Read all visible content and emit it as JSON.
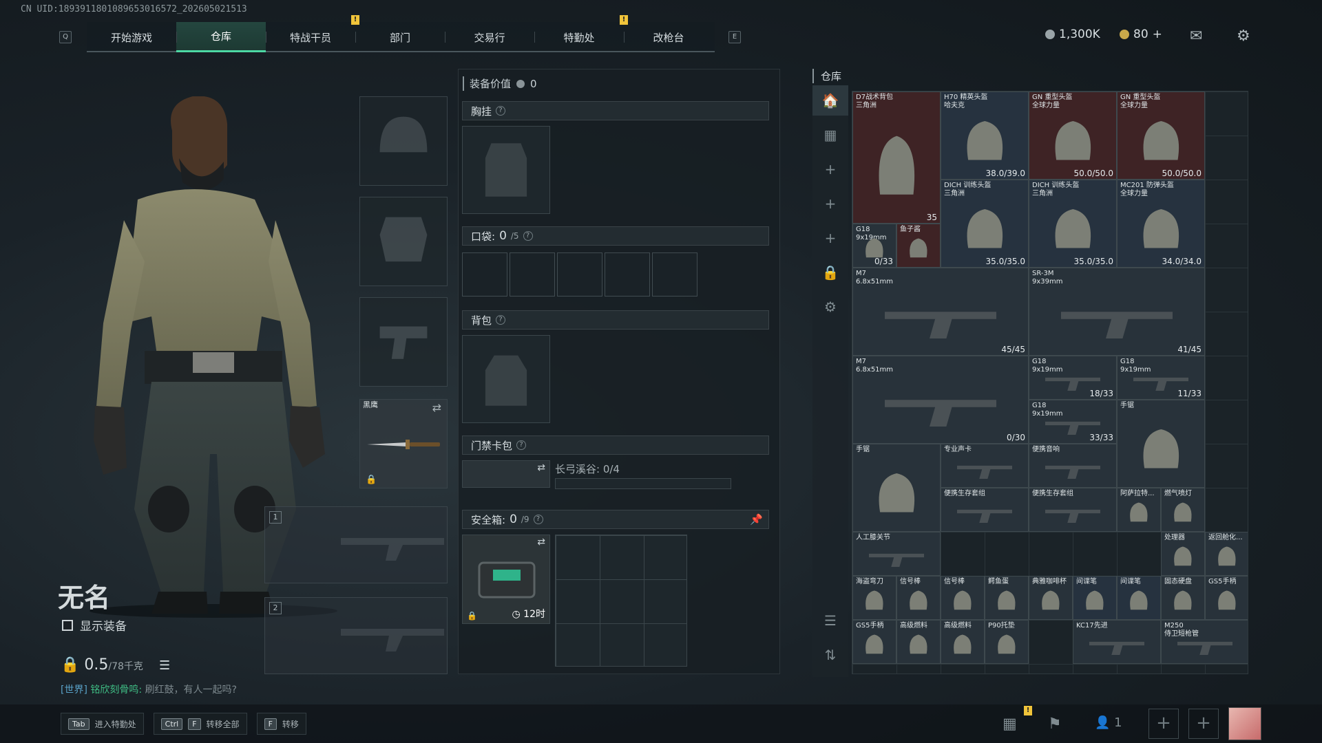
{
  "uid": "CN UID:1893911801089653016572_202605021513",
  "nav": {
    "left_key": "Q",
    "right_key": "E",
    "tabs": [
      {
        "label": "开始游戏",
        "active": false,
        "alert": false
      },
      {
        "label": "仓库",
        "active": true,
        "alert": false
      },
      {
        "label": "特战干员",
        "active": false,
        "alert": true
      },
      {
        "label": "部门",
        "active": false,
        "alert": false
      },
      {
        "label": "交易行",
        "active": false,
        "alert": false
      },
      {
        "label": "特勤处",
        "active": false,
        "alert": true
      },
      {
        "label": "改枪台",
        "active": false,
        "alert": false
      }
    ],
    "alert_symbol": "!"
  },
  "currency": {
    "money": "1,300K",
    "coin": "80",
    "coin_add": "+"
  },
  "character": {
    "name": "无名",
    "show_equipment": "显示装备",
    "weight": "0.5",
    "weight_max": "/78千克",
    "melee_name": "黑鹰",
    "weapon_slot_1": "1",
    "weapon_slot_2": "2"
  },
  "chat": {
    "channel": "[世界]",
    "user": "铭欣刻骨鸣:",
    "message": "刷红鼓，有人一起吗?"
  },
  "bottom_keys": [
    {
      "keys": [
        "Tab"
      ],
      "label": "进入特勤处"
    },
    {
      "keys": [
        "Ctrl",
        "F"
      ],
      "label": "转移全部"
    },
    {
      "keys": [
        "F"
      ],
      "label": "转移"
    }
  ],
  "loadout": {
    "value_label": "装备价值",
    "value": "0",
    "chest_rig": "胸挂",
    "pocket_label": "口袋:",
    "pocket_count": "0",
    "pocket_max": "/5",
    "backpack": "背包",
    "keycard": "门禁卡包",
    "keycard_map": "长弓溪谷: 0/4",
    "safebox_label": "安全箱:",
    "safebox_count": "0",
    "safebox_max": "/9",
    "safebox_timer": "12时",
    "help": "?"
  },
  "warehouse": {
    "title": "仓库",
    "items": [
      {
        "name": "D7战术背包",
        "sub": "三角洲",
        "count": "35",
        "style": "red"
      },
      {
        "name": "H70 精英头盔",
        "sub": "哈夫克",
        "count": "38.0/39.0",
        "style": "blue"
      },
      {
        "name": "GN 重型头盔",
        "sub": "全球力量",
        "count": "50.0/50.0",
        "style": "red"
      },
      {
        "name": "GN 重型头盔",
        "sub": "全球力量",
        "count": "50.0/50.0",
        "style": "red"
      },
      {
        "name": "DICH 训练头盔",
        "sub": "三角洲",
        "count": "35.0/35.0",
        "style": "blue"
      },
      {
        "name": "DICH 训练头盔",
        "sub": "三角洲",
        "count": "35.0/35.0",
        "style": "blue"
      },
      {
        "name": "MC201 防弹头盔",
        "sub": "全球力量",
        "count": "34.0/34.0",
        "style": "blue"
      },
      {
        "name": "G18",
        "sub": "9x19mm",
        "count": "0/33",
        "style": ""
      },
      {
        "name": "鱼子酱",
        "sub": "",
        "count": "",
        "style": "red"
      },
      {
        "name": "M7",
        "sub": "6.8x51mm",
        "count": "45/45",
        "style": ""
      },
      {
        "name": "SR-3M",
        "sub": "9x39mm",
        "count": "41/45",
        "style": ""
      },
      {
        "name": "M7",
        "sub": "6.8x51mm",
        "count": "0/30",
        "style": ""
      },
      {
        "name": "G18",
        "sub": "9x19mm",
        "count": "18/33",
        "style": ""
      },
      {
        "name": "G18",
        "sub": "9x19mm",
        "count": "11/33",
        "style": ""
      },
      {
        "name": "G18",
        "sub": "9x19mm",
        "count": "33/33",
        "style": ""
      },
      {
        "name": "手锯",
        "sub": "",
        "count": "",
        "style": ""
      },
      {
        "name": "手锯",
        "sub": "",
        "count": "",
        "style": ""
      },
      {
        "name": "专业声卡",
        "sub": "",
        "count": "",
        "style": ""
      },
      {
        "name": "便携音响",
        "sub": "",
        "count": "",
        "style": ""
      },
      {
        "name": "阿萨拉特...",
        "sub": "",
        "count": "",
        "style": ""
      },
      {
        "name": "便携生存套组",
        "sub": "",
        "count": "",
        "style": ""
      },
      {
        "name": "便携生存套组",
        "sub": "",
        "count": "",
        "style": ""
      },
      {
        "name": "燃气喷灯",
        "sub": "",
        "count": "",
        "style": ""
      },
      {
        "name": "人工膝关节",
        "sub": "",
        "count": "",
        "style": ""
      },
      {
        "name": "处理器",
        "sub": "",
        "count": "",
        "style": ""
      },
      {
        "name": "返回舱化...",
        "sub": "",
        "count": "",
        "style": ""
      },
      {
        "name": "海盗弯刀",
        "sub": "",
        "count": "",
        "style": ""
      },
      {
        "name": "信号棒",
        "sub": "",
        "count": "",
        "style": ""
      },
      {
        "name": "信号棒",
        "sub": "",
        "count": "",
        "style": ""
      },
      {
        "name": "鳄鱼蛋",
        "sub": "",
        "count": "",
        "style": ""
      },
      {
        "name": "典雅咖啡杯",
        "sub": "",
        "count": "",
        "style": ""
      },
      {
        "name": "间谍笔",
        "sub": "",
        "count": "",
        "style": "blue"
      },
      {
        "name": "间谍笔",
        "sub": "",
        "count": "",
        "style": "blue"
      },
      {
        "name": "固态硬盘",
        "sub": "",
        "count": "",
        "style": ""
      },
      {
        "name": "GS5手柄",
        "sub": "",
        "count": "",
        "style": ""
      },
      {
        "name": "GS5手柄",
        "sub": "",
        "count": "",
        "style": ""
      },
      {
        "name": "高级燃料",
        "sub": "",
        "count": "",
        "style": ""
      },
      {
        "name": "高级燃料",
        "sub": "",
        "count": "",
        "style": ""
      },
      {
        "name": "P90托垫",
        "sub": "",
        "count": "",
        "style": ""
      },
      {
        "name": "KC17先进",
        "sub": "",
        "count": "",
        "style": ""
      },
      {
        "name": "M250",
        "sub": "侍卫短枪管",
        "count": "",
        "style": ""
      }
    ]
  },
  "bottom_right": {
    "friends": "1",
    "alert": "!"
  }
}
